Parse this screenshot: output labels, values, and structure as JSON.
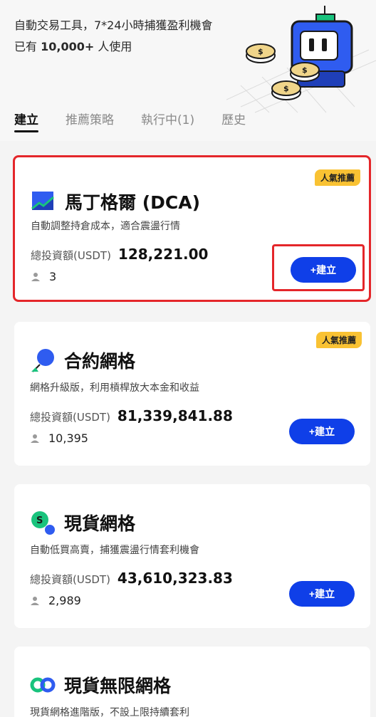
{
  "header": {
    "description": "自動交易工具，7*24小時捕獲盈利機會",
    "users_prefix": "已有 ",
    "users_count": "10,000+",
    "users_suffix": " 人使用"
  },
  "tabs": [
    {
      "label": "建立",
      "active": true
    },
    {
      "label": "推薦策略",
      "active": false
    },
    {
      "label": "執行中(1)",
      "active": false
    },
    {
      "label": "歷史",
      "active": false
    }
  ],
  "strategies": [
    {
      "badge": "人氣推薦",
      "title": "馬丁格爾 (DCA)",
      "description": "自動調整持倉成本，適合震盪行情",
      "invest_label": "總投資額(USDT)",
      "invest_value": "128,221.00",
      "users": "3",
      "button": "+建立",
      "icon": "martingale-chart-icon"
    },
    {
      "badge": "人氣推薦",
      "title": "合約網格",
      "description": "網格升級版，利用槓桿放大本金和收益",
      "invest_label": "總投資額(USDT)",
      "invest_value": "81,339,841.88",
      "users": "10,395",
      "button": "+建立",
      "icon": "futures-grid-icon"
    },
    {
      "title": "現貨網格",
      "description": "自動低買高賣，捕獲震盪行情套利機會",
      "invest_label": "總投資額(USDT)",
      "invest_value": "43,610,323.83",
      "users": "2,989",
      "button": "+建立",
      "icon": "spot-grid-icon"
    },
    {
      "title": "現貨無限網格",
      "description": "現貨網格進階版，不設上限持續套利",
      "icon": "infinity-grid-icon"
    }
  ],
  "colors": {
    "accent_blue": "#0f3fe8",
    "badge_yellow": "#f9c233",
    "highlight_red": "#e4262a",
    "green": "#19c37d"
  }
}
